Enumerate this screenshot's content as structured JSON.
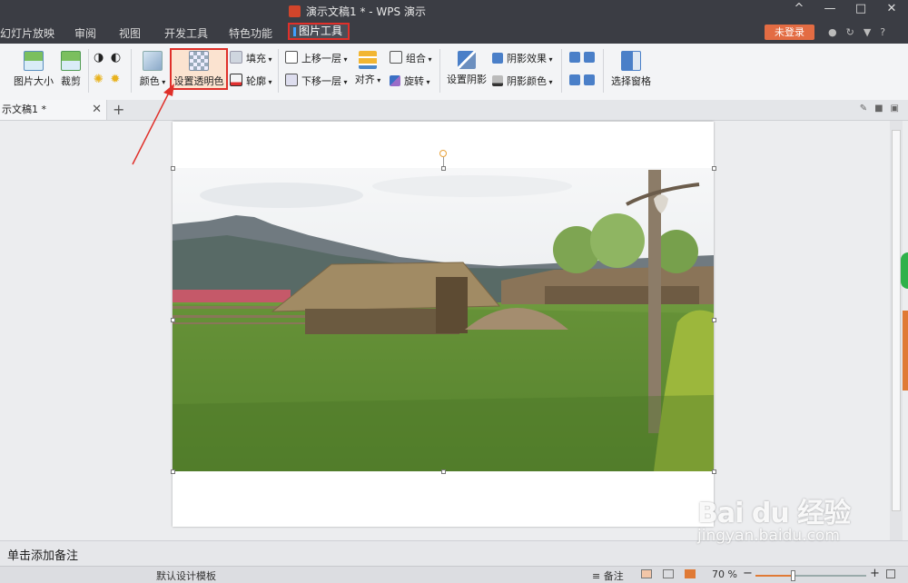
{
  "window": {
    "title": "演示文稿1 * - WPS 演示",
    "controls": [
      "^",
      "—",
      "□",
      "✕"
    ]
  },
  "menu": {
    "items": [
      "幻灯片放映",
      "审阅",
      "视图",
      "开发工具",
      "特色功能"
    ],
    "active": "图片工具",
    "login": "未登录"
  },
  "ribbon": {
    "size": "图片大小",
    "crop": "裁剪",
    "color": "颜色",
    "set_transparent": "设置透明色",
    "fill": "填充",
    "outline": "轮廓",
    "bring_forward": "上移一层",
    "send_backward": "下移一层",
    "align": "对齐",
    "group": "组合",
    "rotate": "旋转",
    "set_shadow": "设置阴影",
    "shadow_effect": "阴影效果",
    "shadow_color": "阴影颜色",
    "selection_pane": "选择窗格"
  },
  "tab": {
    "doc_name": "示文稿1 *",
    "close": "✕",
    "add": "+"
  },
  "notes": {
    "placeholder": "单击添加备注"
  },
  "status": {
    "template": "默认设计模板",
    "notes": "备注",
    "zoom_label": "70 %",
    "zoom_percent": 70,
    "zoom_minus": "−",
    "zoom_plus": "+"
  },
  "watermark": {
    "logo": "Bai du 经验",
    "url": "jingyan.baidu.com"
  },
  "colors": {
    "accent": "#e0302a",
    "titlebar": "#3b3d44",
    "login": "#e36c43"
  }
}
